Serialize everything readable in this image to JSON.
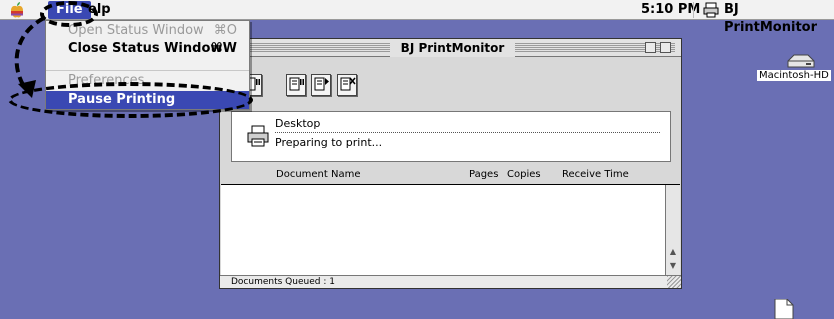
{
  "menubar": {
    "file_menu": "File",
    "help_menu": "Help",
    "help_visible": "elp",
    "clock": "5:10 PM",
    "app_name": "BJ PrintMonitor"
  },
  "file_menu_items": [
    {
      "label": "Open Status Window",
      "shortcut": "⌘O",
      "enabled": false
    },
    {
      "label": "Close Status Window",
      "shortcut": "⌘W",
      "enabled": true
    },
    {
      "label": "Preferences",
      "shortcut": "",
      "enabled": false
    },
    {
      "label": "Pause Printing",
      "shortcut": "",
      "enabled": true,
      "selected": true
    }
  ],
  "window": {
    "title": "BJ PrintMonitor",
    "status": {
      "printer": "Desktop",
      "message": "Preparing to print..."
    },
    "columns": [
      "Document Name",
      "Pages",
      "Copies",
      "Receive Time"
    ],
    "documents": [],
    "statusbar": "Documents Queued : 1"
  },
  "desktop": {
    "disk_label": "Macintosh-HD"
  },
  "colors": {
    "desktop": "#6a6fb4",
    "menu_highlight": "#3a48b3"
  }
}
